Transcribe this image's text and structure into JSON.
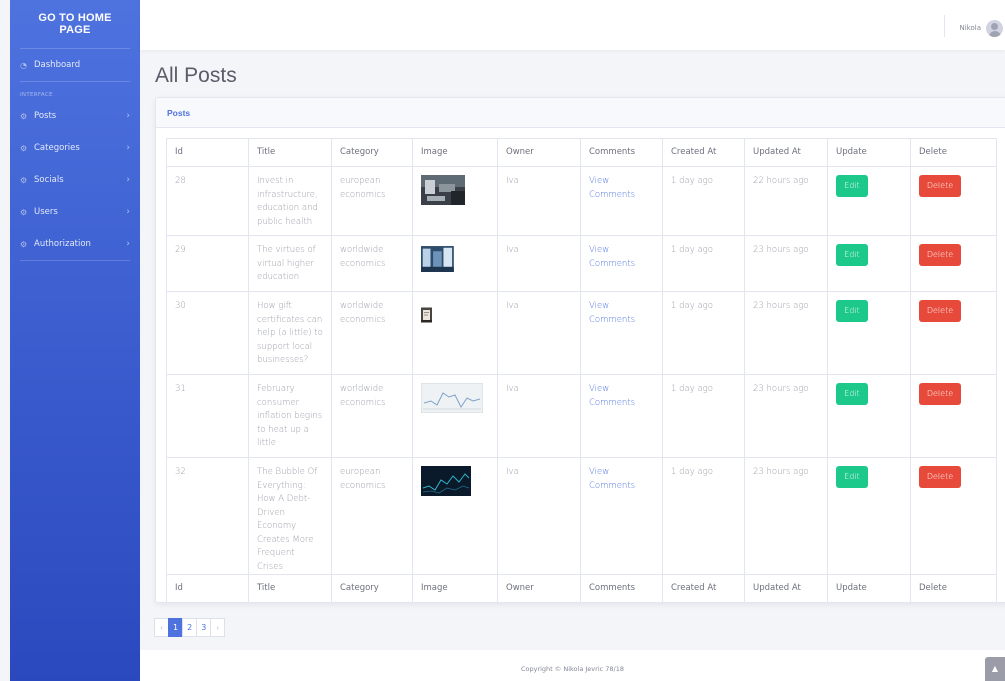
{
  "sidebar": {
    "brand": "GO TO HOME PAGE",
    "dashboard": "Dashboard",
    "heading": "INTERFACE",
    "items": [
      {
        "label": "Posts"
      },
      {
        "label": "Categories"
      },
      {
        "label": "Socials"
      },
      {
        "label": "Users"
      },
      {
        "label": "Authorization"
      }
    ]
  },
  "topbar": {
    "user_name": "Nikola"
  },
  "page_title": "All Posts",
  "card_title": "Posts",
  "table": {
    "columns": [
      "Id",
      "Title",
      "Category",
      "Image",
      "Owner",
      "Comments",
      "Created At",
      "Updated At",
      "Update",
      "Delete"
    ],
    "rows": [
      {
        "id": "28",
        "title": "Invest in infrastructure, education and public health",
        "category": "european economics",
        "owner": "Iva",
        "comments": "View Comments",
        "created": "1 day ago",
        "updated": "22 hours ago",
        "edit": "Edit",
        "delete": "Delete"
      },
      {
        "id": "29",
        "title": "The virtues of virtual higher education",
        "category": "worldwide economics",
        "owner": "Iva",
        "comments": "View Comments",
        "created": "1 day ago",
        "updated": "23 hours ago",
        "edit": "Edit",
        "delete": "Delete"
      },
      {
        "id": "30",
        "title": "How gift certificates can help (a little) to support local businesses?",
        "category": "worldwide economics",
        "owner": "Iva",
        "comments": "View Comments",
        "created": "1 day ago",
        "updated": "23 hours ago",
        "edit": "Edit",
        "delete": "Delete"
      },
      {
        "id": "31",
        "title": "February consumer inflation begins to heat up a little",
        "category": "worldwide economics",
        "owner": "Iva",
        "comments": "View Comments",
        "created": "1 day ago",
        "updated": "23 hours ago",
        "edit": "Edit",
        "delete": "Delete"
      },
      {
        "id": "32",
        "title": "The Bubble Of Everything: How A Debt-Driven Economy Creates More Frequent Crises",
        "category": "european economics",
        "owner": "Iva",
        "comments": "View Comments",
        "created": "1 day ago",
        "updated": "23 hours ago",
        "edit": "Edit",
        "delete": "Delete"
      }
    ]
  },
  "pagination": {
    "prev": "‹",
    "pages": [
      "1",
      "2",
      "3"
    ],
    "next": "›",
    "active": "1"
  },
  "footer": "Copyright © Nikola Jevric 78/18",
  "colors": {
    "primary": "#4e73df",
    "success": "#1cc88a",
    "danger": "#e74a3b"
  }
}
